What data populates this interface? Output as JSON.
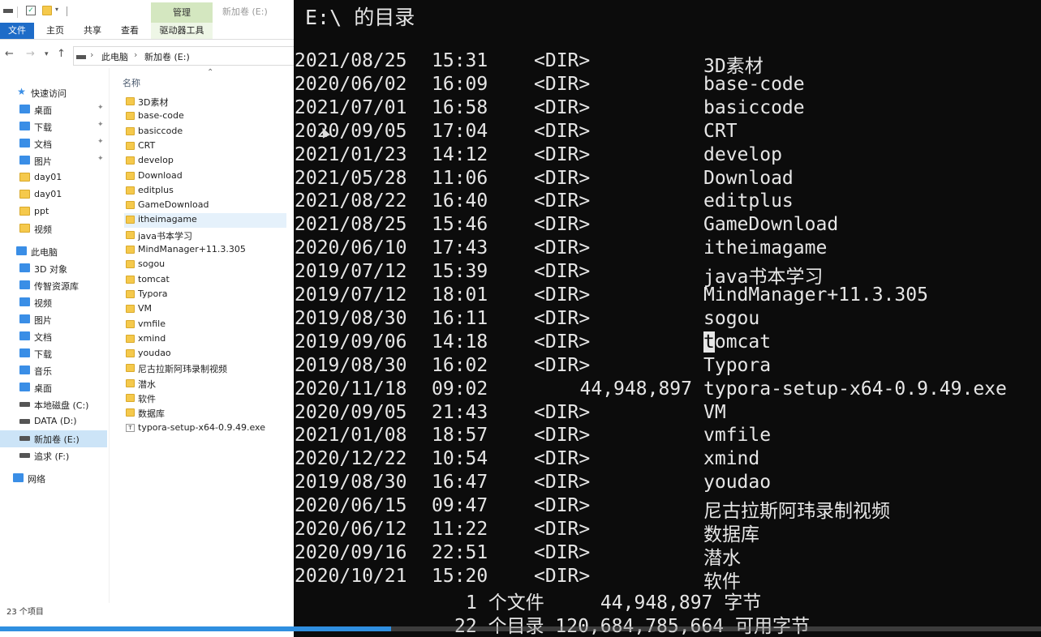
{
  "explorer": {
    "window_title": "新加卷 (E:)",
    "context_tab": "管理",
    "ribbon_tabs": [
      "文件",
      "主页",
      "共享",
      "查看",
      "驱动器工具"
    ],
    "breadcrumb": [
      "此电脑",
      "新加卷 (E:)"
    ],
    "column_header": "名称",
    "nav": [
      {
        "label": "快速访问",
        "icon": "star-icon",
        "pinned": false
      },
      {
        "label": "桌面",
        "icon": "desktop-icon",
        "pinned": true
      },
      {
        "label": "下载",
        "icon": "download-icon",
        "pinned": true
      },
      {
        "label": "文档",
        "icon": "document-icon",
        "pinned": true
      },
      {
        "label": "图片",
        "icon": "picture-icon",
        "pinned": true
      },
      {
        "label": "day01",
        "icon": "folder-icon",
        "pinned": false
      },
      {
        "label": "day01",
        "icon": "folder-icon",
        "pinned": false
      },
      {
        "label": "ppt",
        "icon": "folder-icon",
        "pinned": false
      },
      {
        "label": "视频",
        "icon": "folder-icon",
        "pinned": false
      },
      {
        "label": "此电脑",
        "icon": "computer-icon",
        "pinned": false
      },
      {
        "label": "3D 对象",
        "icon": "3d-objects-icon",
        "pinned": false
      },
      {
        "label": "传智资源库",
        "icon": "network-share-icon",
        "pinned": false
      },
      {
        "label": "视频",
        "icon": "video-icon",
        "pinned": false
      },
      {
        "label": "图片",
        "icon": "picture-icon",
        "pinned": false
      },
      {
        "label": "文档",
        "icon": "document-icon",
        "pinned": false
      },
      {
        "label": "下载",
        "icon": "download-icon",
        "pinned": false
      },
      {
        "label": "音乐",
        "icon": "music-icon",
        "pinned": false
      },
      {
        "label": "桌面",
        "icon": "desktop-icon",
        "pinned": false
      },
      {
        "label": "本地磁盘 (C:)",
        "icon": "drive-icon",
        "pinned": false
      },
      {
        "label": "DATA (D:)",
        "icon": "drive-icon",
        "pinned": false
      },
      {
        "label": "新加卷 (E:)",
        "icon": "drive-icon",
        "pinned": false,
        "selected": true
      },
      {
        "label": "追求 (F:)",
        "icon": "drive-icon",
        "pinned": false
      },
      {
        "label": "网络",
        "icon": "network-icon",
        "pinned": false
      }
    ],
    "files": [
      {
        "name": "3D素材",
        "type": "folder"
      },
      {
        "name": "base-code",
        "type": "folder"
      },
      {
        "name": "basiccode",
        "type": "folder"
      },
      {
        "name": "CRT",
        "type": "folder"
      },
      {
        "name": "develop",
        "type": "folder"
      },
      {
        "name": "Download",
        "type": "folder"
      },
      {
        "name": "editplus",
        "type": "folder"
      },
      {
        "name": "GameDownload",
        "type": "folder"
      },
      {
        "name": "itheimagame",
        "type": "folder",
        "hovered": true
      },
      {
        "name": "java书本学习",
        "type": "folder"
      },
      {
        "name": "MindManager+11.3.305",
        "type": "folder"
      },
      {
        "name": "sogou",
        "type": "folder"
      },
      {
        "name": "tomcat",
        "type": "folder"
      },
      {
        "name": "Typora",
        "type": "folder"
      },
      {
        "name": "VM",
        "type": "folder"
      },
      {
        "name": "vmfile",
        "type": "folder"
      },
      {
        "name": "xmind",
        "type": "folder"
      },
      {
        "name": "youdao",
        "type": "folder"
      },
      {
        "name": "尼古拉斯阿玮录制视频",
        "type": "folder"
      },
      {
        "name": "潜水",
        "type": "folder"
      },
      {
        "name": "软件",
        "type": "folder"
      },
      {
        "name": "数据库",
        "type": "folder"
      },
      {
        "name": "typora-setup-x64-0.9.49.exe",
        "type": "file"
      }
    ],
    "status": "23 个项目"
  },
  "terminal": {
    "title": "E:\\ 的目录",
    "entries": [
      {
        "date": "2021/08/25",
        "time": "15:31",
        "dir": "<DIR>",
        "size": "",
        "name": "3D素材"
      },
      {
        "date": "2020/06/02",
        "time": "16:09",
        "dir": "<DIR>",
        "size": "",
        "name": "base-code"
      },
      {
        "date": "2021/07/01",
        "time": "16:58",
        "dir": "<DIR>",
        "size": "",
        "name": "basiccode"
      },
      {
        "date": "2020/09/05",
        "time": "17:04",
        "dir": "<DIR>",
        "size": "",
        "name": "CRT"
      },
      {
        "date": "2021/01/23",
        "time": "14:12",
        "dir": "<DIR>",
        "size": "",
        "name": "develop"
      },
      {
        "date": "2021/05/28",
        "time": "11:06",
        "dir": "<DIR>",
        "size": "",
        "name": "Download"
      },
      {
        "date": "2021/08/22",
        "time": "16:40",
        "dir": "<DIR>",
        "size": "",
        "name": "editplus"
      },
      {
        "date": "2021/08/25",
        "time": "15:46",
        "dir": "<DIR>",
        "size": "",
        "name": "GameDownload"
      },
      {
        "date": "2020/06/10",
        "time": "17:43",
        "dir": "<DIR>",
        "size": "",
        "name": "itheimagame"
      },
      {
        "date": "2019/07/12",
        "time": "15:39",
        "dir": "<DIR>",
        "size": "",
        "name": "java书本学习"
      },
      {
        "date": "2019/07/12",
        "time": "18:01",
        "dir": "<DIR>",
        "size": "",
        "name": "MindManager+11.3.305"
      },
      {
        "date": "2019/08/30",
        "time": "16:11",
        "dir": "<DIR>",
        "size": "",
        "name": "sogou"
      },
      {
        "date": "2019/09/06",
        "time": "14:18",
        "dir": "<DIR>",
        "size": "",
        "name": "tomcat",
        "cursor": true
      },
      {
        "date": "2019/08/30",
        "time": "16:02",
        "dir": "<DIR>",
        "size": "",
        "name": "Typora"
      },
      {
        "date": "2020/11/18",
        "time": "09:02",
        "dir": "",
        "size": "44,948,897",
        "name": "typora-setup-x64-0.9.49.exe"
      },
      {
        "date": "2020/09/05",
        "time": "21:43",
        "dir": "<DIR>",
        "size": "",
        "name": "VM"
      },
      {
        "date": "2021/01/08",
        "time": "18:57",
        "dir": "<DIR>",
        "size": "",
        "name": "vmfile"
      },
      {
        "date": "2020/12/22",
        "time": "10:54",
        "dir": "<DIR>",
        "size": "",
        "name": "xmind"
      },
      {
        "date": "2019/08/30",
        "time": "16:47",
        "dir": "<DIR>",
        "size": "",
        "name": "youdao"
      },
      {
        "date": "2020/06/15",
        "time": "09:47",
        "dir": "<DIR>",
        "size": "",
        "name": "尼古拉斯阿玮录制视频"
      },
      {
        "date": "2020/06/12",
        "time": "11:22",
        "dir": "<DIR>",
        "size": "",
        "name": "数据库"
      },
      {
        "date": "2020/09/16",
        "time": "22:51",
        "dir": "<DIR>",
        "size": "",
        "name": "潜水"
      },
      {
        "date": "2020/10/21",
        "time": "15:20",
        "dir": "<DIR>",
        "size": "",
        "name": "软件"
      }
    ],
    "summary_files": "1 个文件     44,948,897 字节",
    "summary_dirs": "22 个目录 120,684,785,664 可用字节"
  },
  "video": {
    "progress_fraction": 0.376,
    "progress_color": "#2f8fe0"
  }
}
